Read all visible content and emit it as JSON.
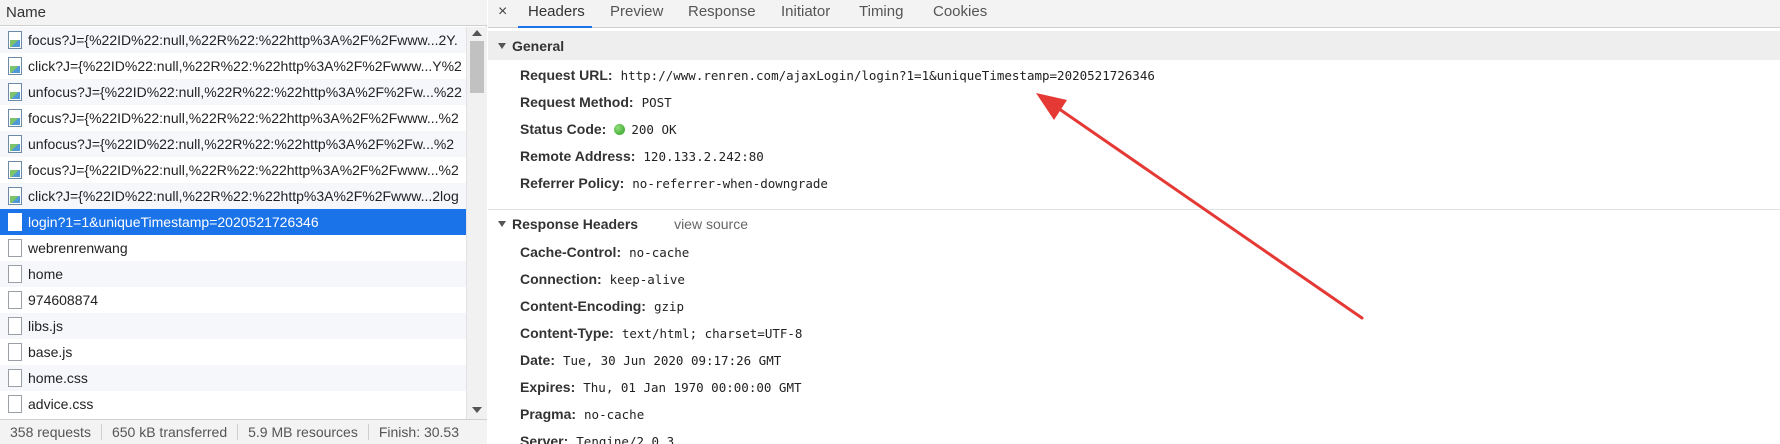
{
  "left": {
    "header": "Name",
    "requests": [
      {
        "label": "focus?J={%22ID%22:null,%22R%22:%22http%3A%2F%2Fwww...2Y.",
        "icon": "image-file-icon"
      },
      {
        "label": "click?J={%22ID%22:null,%22R%22:%22http%3A%2F%2Fwww...Y%2",
        "icon": "image-file-icon"
      },
      {
        "label": "unfocus?J={%22ID%22:null,%22R%22:%22http%3A%2F%2Fw...%22",
        "icon": "image-file-icon"
      },
      {
        "label": "focus?J={%22ID%22:null,%22R%22:%22http%3A%2F%2Fwww...%2",
        "icon": "image-file-icon"
      },
      {
        "label": "unfocus?J={%22ID%22:null,%22R%22:%22http%3A%2F%2Fw...%2",
        "icon": "image-file-icon"
      },
      {
        "label": "focus?J={%22ID%22:null,%22R%22:%22http%3A%2F%2Fwww...%2",
        "icon": "image-file-icon"
      },
      {
        "label": "click?J={%22ID%22:null,%22R%22:%22http%3A%2F%2Fwww...2log",
        "icon": "image-file-icon"
      },
      {
        "label": "login?1=1&uniqueTimestamp=2020521726346",
        "icon": "document-file-icon",
        "selected": true
      },
      {
        "label": "webrenrenwang",
        "icon": "document-file-icon"
      },
      {
        "label": "home",
        "icon": "document-file-icon"
      },
      {
        "label": "974608874",
        "icon": "document-file-icon"
      },
      {
        "label": "libs.js",
        "icon": "document-file-icon"
      },
      {
        "label": "base.js",
        "icon": "document-file-icon"
      },
      {
        "label": "home.css",
        "icon": "document-file-icon"
      },
      {
        "label": "advice.css",
        "icon": "document-file-icon"
      }
    ],
    "status": {
      "requests": "358 requests",
      "transferred": "650 kB transferred",
      "resources": "5.9 MB resources",
      "finish": "Finish: 30.53"
    }
  },
  "right": {
    "close": "×",
    "tabs": [
      "Headers",
      "Preview",
      "Response",
      "Initiator",
      "Timing",
      "Cookies"
    ],
    "active_tab": "Headers",
    "general": {
      "title": "General",
      "items": [
        {
          "key": "Request URL:",
          "value": "http://www.renren.com/ajaxLogin/login?1=1&uniqueTimestamp=2020521726346"
        },
        {
          "key": "Request Method:",
          "value": "POST"
        },
        {
          "key": "Status Code:",
          "value": "200 OK",
          "status_dot": "#3cb32c"
        },
        {
          "key": "Remote Address:",
          "value": "120.133.2.242:80"
        },
        {
          "key": "Referrer Policy:",
          "value": "no-referrer-when-downgrade"
        }
      ]
    },
    "response_headers": {
      "title": "Response Headers",
      "view_source": "view source",
      "items": [
        {
          "key": "Cache-Control:",
          "value": "no-cache"
        },
        {
          "key": "Connection:",
          "value": "keep-alive"
        },
        {
          "key": "Content-Encoding:",
          "value": "gzip"
        },
        {
          "key": "Content-Type:",
          "value": "text/html; charset=UTF-8"
        },
        {
          "key": "Date:",
          "value": "Tue, 30 Jun 2020 09:17:26 GMT"
        },
        {
          "key": "Expires:",
          "value": "Thu, 01 Jan 1970 00:00:00 GMT"
        },
        {
          "key": "Pragma:",
          "value": "no-cache"
        },
        {
          "key": "Server:",
          "value": "Tengine/2.0.3"
        }
      ]
    }
  },
  "colors": {
    "selection": "#1a73e8",
    "annotation_arrow": "#e53935"
  }
}
